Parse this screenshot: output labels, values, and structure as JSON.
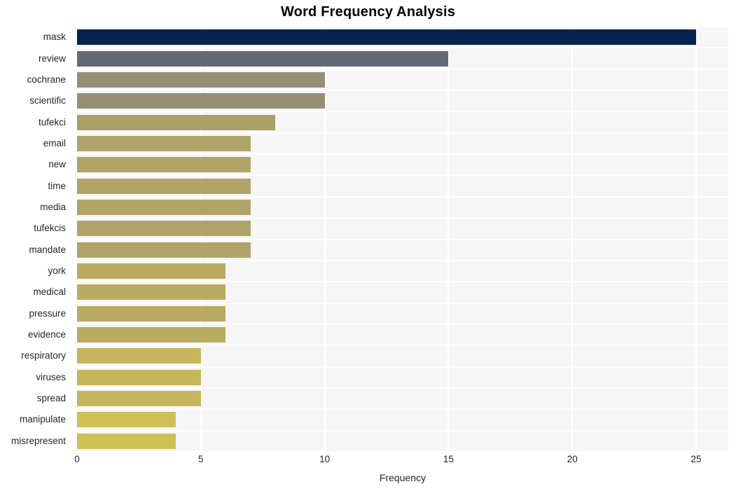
{
  "chart_data": {
    "type": "bar",
    "orientation": "horizontal",
    "title": "Word Frequency Analysis",
    "xlabel": "Frequency",
    "ylabel": "",
    "xlim": [
      0,
      26.3
    ],
    "xticks": [
      0,
      5,
      10,
      15,
      20,
      25
    ],
    "xtick_labels": [
      "0",
      "5",
      "10",
      "15",
      "20",
      "25"
    ],
    "grid": true,
    "legend": null,
    "categories": [
      "mask",
      "review",
      "cochrane",
      "scientific",
      "tufekci",
      "email",
      "new",
      "time",
      "media",
      "tufekcis",
      "mandate",
      "york",
      "medical",
      "pressure",
      "evidence",
      "respiratory",
      "viruses",
      "spread",
      "manipulate",
      "misrepresent"
    ],
    "values": [
      25,
      15,
      10,
      10,
      8,
      7,
      7,
      7,
      7,
      7,
      7,
      6,
      6,
      6,
      6,
      5,
      5,
      5,
      4,
      4
    ],
    "bar_colors": [
      "#04224c",
      "#666a77",
      "#948f76",
      "#948f75",
      "#ab9f68",
      "#b0a468",
      "#b0a468",
      "#b0a468",
      "#b0a468",
      "#b0a468",
      "#b0a468",
      "#bbab61",
      "#bbab61",
      "#bbab61",
      "#bbab61",
      "#c5b55c",
      "#c5b55c",
      "#c5b55c",
      "#cec055",
      "#cec055"
    ]
  },
  "style": {
    "plot_background": "#f6f6f7",
    "page_background": "#ffffff",
    "grid_color": "#ffffff",
    "text_color": "#262626",
    "title_color": "#000000"
  }
}
